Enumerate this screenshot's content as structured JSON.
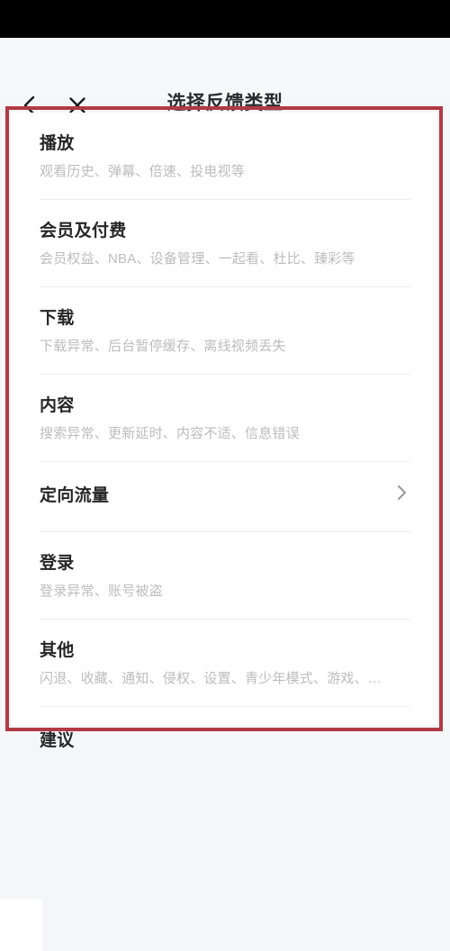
{
  "statusbar": {
    "background": "#000000"
  },
  "header": {
    "title": "选择反馈类型",
    "back_icon": "chevron-left-icon",
    "close_icon": "close-icon",
    "background": "#f7f8fa"
  },
  "annotation": {
    "color": "#b23a45",
    "shape": "rectangle"
  },
  "theme": {
    "card_background": "#ffffff",
    "page_background": "#f5f6f8",
    "title_color": "#262626",
    "subtitle_color": "#bcbcbc",
    "divider_color": "#eeeeee"
  },
  "list": {
    "items": [
      {
        "title": "播放",
        "subtitle": "观看历史、弹幕、倍速、投电视等",
        "has_arrow": false
      },
      {
        "title": "会员及付费",
        "subtitle": "会员权益、NBA、设备管理、一起看、杜比、臻彩等",
        "has_arrow": false
      },
      {
        "title": "下载",
        "subtitle": "下载异常、后台暂停缓存、离线视频丢失",
        "has_arrow": false
      },
      {
        "title": "内容",
        "subtitle": "搜索异常、更新延时、内容不适、信息错误",
        "has_arrow": false
      },
      {
        "title": "定向流量",
        "subtitle": "",
        "has_arrow": true,
        "arrow_icon": "chevron-right-icon"
      },
      {
        "title": "登录",
        "subtitle": "登录异常、账号被盗",
        "has_arrow": false
      },
      {
        "title": "其他",
        "subtitle": "闪退、收藏、通知、侵权、设置、青少年模式、游戏、…",
        "has_arrow": false
      },
      {
        "title": "建议",
        "subtitle": "",
        "has_arrow": false
      }
    ]
  }
}
